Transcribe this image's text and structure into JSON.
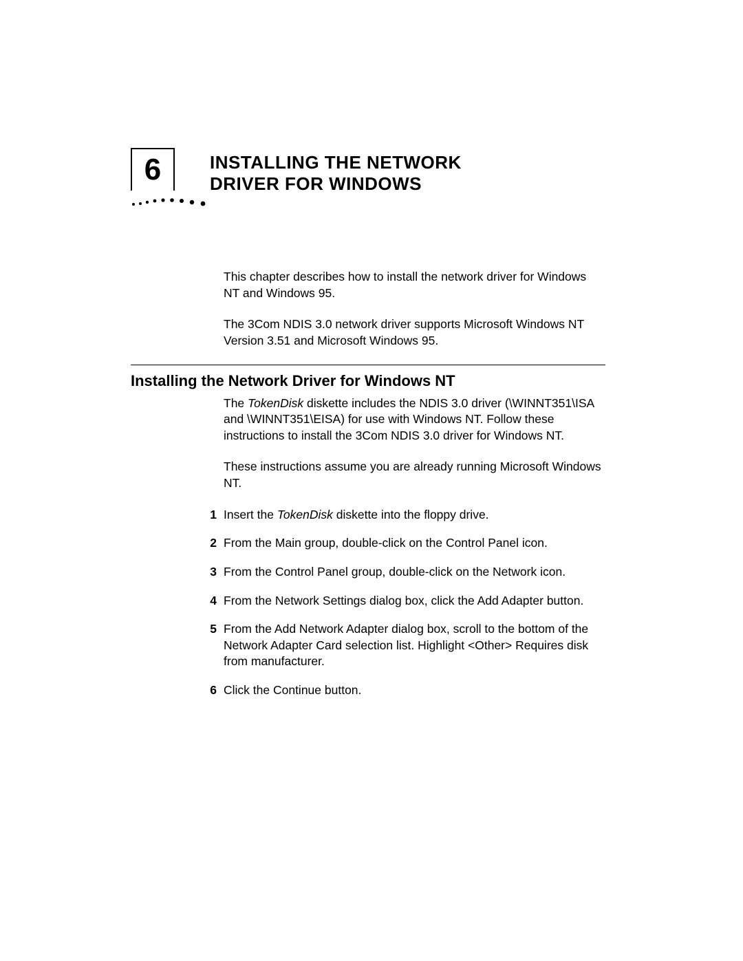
{
  "chapter": {
    "number": "6",
    "title_line1": "Installing the Network",
    "title_line2": "Driver for Windows"
  },
  "intro": {
    "p1": "This chapter describes how to install the network driver for Windows NT and Windows 95.",
    "p2": "The 3Com NDIS 3.0 network driver supports Microsoft Windows NT Version 3.51 and Microsoft Windows 95."
  },
  "section": {
    "heading": "Installing the Network Driver for Windows NT",
    "p1_a": "The ",
    "p1_italic": "TokenDisk",
    "p1_b": " diskette includes the NDIS 3.0 driver (\\WINNT351\\ISA and \\WINNT351\\EISA) for use with Windows NT. Follow these instructions to install the 3Com NDIS 3.0 driver for Windows NT.",
    "p2": "These instructions assume you are already running Microsoft Windows NT.",
    "steps": [
      {
        "n": "1",
        "pre": "Insert the ",
        "it": "TokenDisk",
        "post": " diskette into the floppy drive."
      },
      {
        "n": "2",
        "text": "From the Main group, double-click on the Control Panel icon."
      },
      {
        "n": "3",
        "text": "From the Control Panel group, double-click on the Network icon."
      },
      {
        "n": "4",
        "text": "From the Network Settings dialog box, click the Add Adapter button."
      },
      {
        "n": "5",
        "text": "From the Add Network Adapter dialog box, scroll to the bottom of the Network Adapter Card selection list. Highlight <Other> Requires disk from manufacturer."
      },
      {
        "n": "6",
        "text": "Click the Continue button."
      }
    ]
  }
}
